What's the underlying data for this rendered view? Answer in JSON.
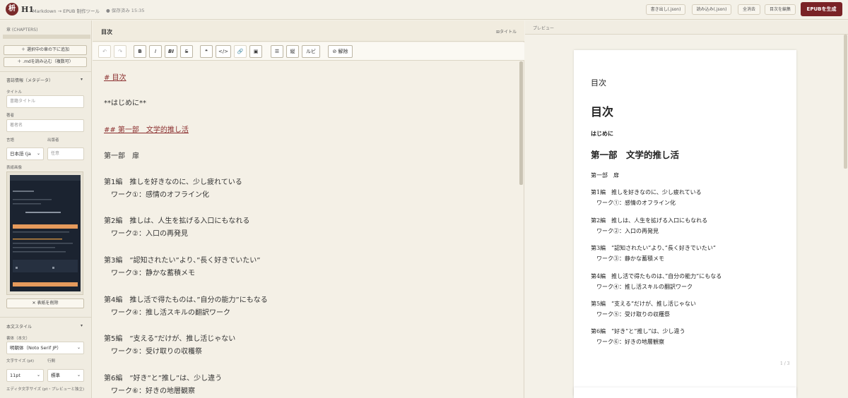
{
  "header": {
    "logo": "枡",
    "brand": "H1",
    "subtitle": "Markdown → EPUB 制作ツール",
    "saved": "● 保存済み 15:35",
    "buttons": [
      "書き出し(.json)",
      "読み込み(.json)",
      "全消去",
      "目次を編集"
    ],
    "generate": "EPUBを生成"
  },
  "sidebar": {
    "chapters_title": "章 (CHAPTERS)",
    "add_below": "＋ 選択中の章の下に追加",
    "load_md": "＋ .mdを読み込む（複数可）",
    "meta_title": "書誌情報（メタデータ）",
    "meta_toggle": "▾",
    "title_label": "タイトル",
    "title_placeholder": "書籍タイトル",
    "author_label": "著者",
    "author_placeholder": "著者名",
    "lang_label": "言語",
    "publisher_label": "出版者",
    "lang_value": "日本語 (ja",
    "publisher_placeholder": "任意",
    "cover_label": "表紙画像",
    "remove_cover": "✕ 表紙を削除",
    "style_title": "本文スタイル",
    "style_toggle": "▾",
    "font_label": "書体（本文）",
    "font_value": "明朝体（Noto Serif JP）",
    "size_label": "文字サイズ (pt)",
    "lineheight_label": "行間",
    "size_value": "11pt",
    "lineheight_value": "標準",
    "editor_size_label": "エディタ文字サイズ (pt・プレビューと独立)"
  },
  "editor": {
    "title": "目次",
    "title_link": "⊞タイトル",
    "toolbar": {
      "undo": "↶",
      "redo": "↷",
      "bold": "B",
      "italic": "I",
      "bolditalic": "BI",
      "strike": "S",
      "quote": "❝",
      "code": "</>",
      "link": "🔗",
      "image": "▣",
      "list": "☰",
      "ruby_kanji": "縦",
      "ruby": "ルビ",
      "clear": "⊘ 解除"
    },
    "lines": [
      "# 目次",
      "**はじめに**",
      "## 第一部　文学的推し活",
      "第一部　扉",
      "第1編　推しを好きなのに、少し疲れている",
      "　ワーク①：感情のオフライン化",
      "第2編　推しは、人生を拡げる入口にもなれる",
      "　ワーク②：入口の再発見",
      "第3編　”認知されたい”より、”長く好きでいたい”",
      "　ワーク③：静かな蓄積メモ",
      "第4編　推し活で得たものは、”自分の能力”にもなる",
      "　ワーク④：推し活スキルの翻訳ワーク",
      "第5編　”支える”だけが、推し活じゃない",
      "　ワーク⑤：受け取りの収穫祭",
      "第6編　”好き”と”推し”は、少し違う",
      "　ワーク⑥：好きの地層観察"
    ]
  },
  "preview": {
    "label": "プレビュー",
    "header": "目次",
    "h1": "目次",
    "intro": "はじめに",
    "h2": "第一部　文学的推し活",
    "lines": [
      "第一部　扉",
      "第1編　推しを好きなのに、少し疲れている",
      "　ワーク①：感情のオフライン化",
      "第2編　推しは、人生を拡げる入口にもなれる",
      "　ワーク②：入口の再発見",
      "第3編　”認知されたい”より、”長く好きでいたい”",
      "　ワーク③：静かな蓄積メモ",
      "第4編　推し活で得たものは、”自分の能力”にもなる",
      "　ワーク④：推し活スキルの翻訳ワーク",
      "第5編　”支える”だけが、推し活じゃない",
      "　ワーク⑤：受け取りの収穫祭",
      "第6編　”好き”と”推し”は、少し違う",
      "　ワーク⑥：好きの地層観察"
    ],
    "page_number": "1 / 3"
  },
  "colors": {
    "accent": "#7a2326",
    "heading_link": "#8a2d2d"
  }
}
